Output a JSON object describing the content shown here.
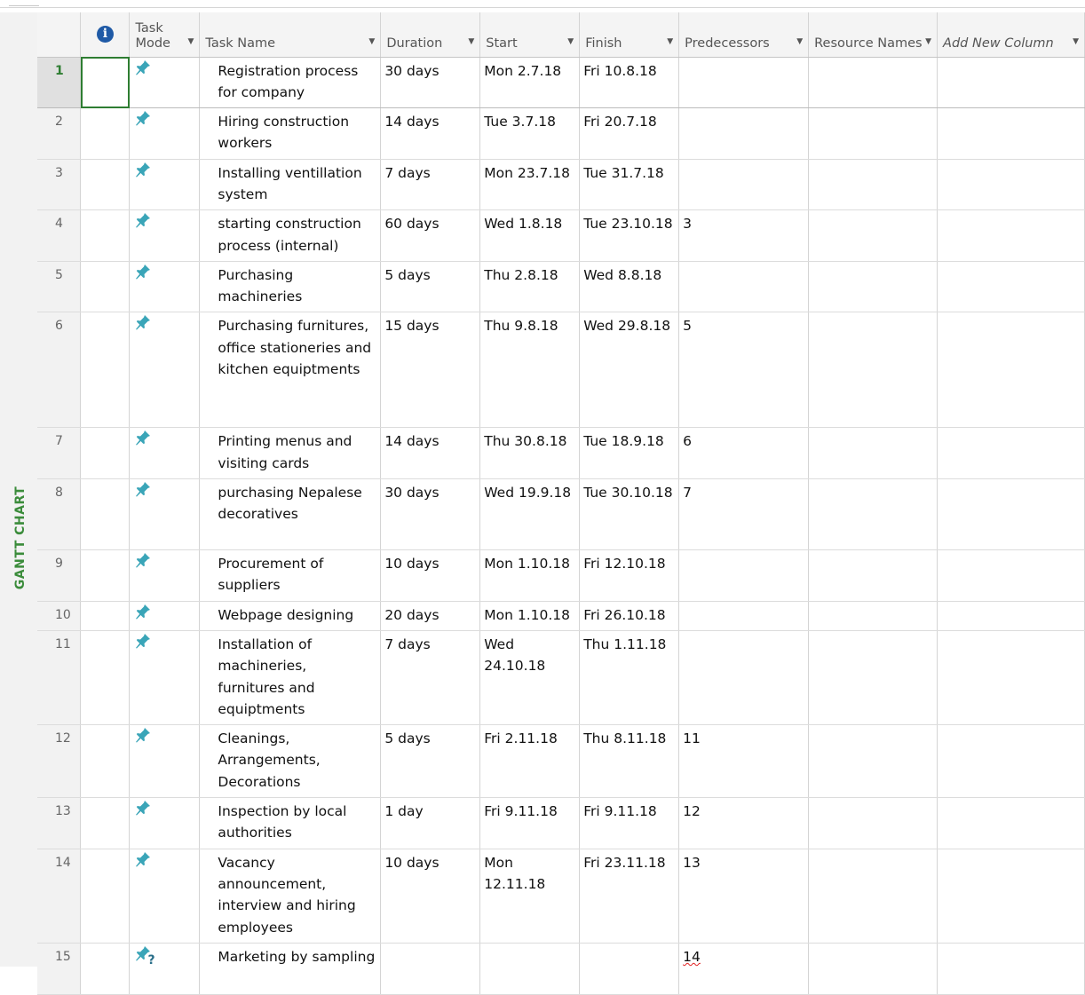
{
  "view": {
    "label": "GANTT CHART"
  },
  "columns": {
    "task_mode": "Task Mode",
    "task_name": "Task Name",
    "duration": "Duration",
    "start": "Start",
    "finish": "Finish",
    "predecessors": "Predecessors",
    "resource_names": "Resource Names",
    "add_new": "Add New Column"
  },
  "icons": {
    "info": "info-icon",
    "manual_pin": "pin-icon",
    "dropdown": "chevron-down-icon"
  },
  "colors": {
    "pin": "#3aa5b8",
    "selected_index": "#2e7d32",
    "view_label": "#3b8c3b",
    "info_icon": "#1f5aa6"
  },
  "tasks": [
    {
      "id": "1",
      "name": "Registration process for company",
      "duration": "30 days",
      "start": "Mon 2.7.18",
      "finish": "Fri 10.8.18",
      "predecessors": "",
      "resources": ""
    },
    {
      "id": "2",
      "name": "Hiring construction workers",
      "duration": "14 days",
      "start": "Tue 3.7.18",
      "finish": "Fri 20.7.18",
      "predecessors": "",
      "resources": ""
    },
    {
      "id": "3",
      "name": "Installing ventillation system",
      "duration": "7 days",
      "start": "Mon 23.7.18",
      "finish": "Tue 31.7.18",
      "predecessors": "",
      "resources": ""
    },
    {
      "id": "4",
      "name": "starting construction process (internal)",
      "duration": "60 days",
      "start": "Wed 1.8.18",
      "finish": "Tue 23.10.18",
      "predecessors": "3",
      "resources": ""
    },
    {
      "id": "5",
      "name": "Purchasing machineries",
      "duration": "5 days",
      "start": "Thu 2.8.18",
      "finish": "Wed 8.8.18",
      "predecessors": "",
      "resources": ""
    },
    {
      "id": "6",
      "name": "Purchasing furnitures, office stationeries and kitchen equiptments",
      "duration": "15 days",
      "start": "Thu 9.8.18",
      "finish": "Wed 29.8.18",
      "predecessors": "5",
      "resources": ""
    },
    {
      "id": "7",
      "name": "Printing menus and visiting cards",
      "duration": "14 days",
      "start": "Thu 30.8.18",
      "finish": "Tue 18.9.18",
      "predecessors": "6",
      "resources": ""
    },
    {
      "id": "8",
      "name": "purchasing Nepalese decoratives",
      "duration": "30 days",
      "start": "Wed 19.9.18",
      "finish": "Tue 30.10.18",
      "predecessors": "7",
      "resources": ""
    },
    {
      "id": "9",
      "name": "Procurement of suppliers",
      "duration": "10 days",
      "start": "Mon 1.10.18",
      "finish": "Fri 12.10.18",
      "predecessors": "",
      "resources": ""
    },
    {
      "id": "10",
      "name": "Webpage designing",
      "duration": "20 days",
      "start": "Mon 1.10.18",
      "finish": "Fri 26.10.18",
      "predecessors": "",
      "resources": ""
    },
    {
      "id": "11",
      "name": "Installation of machineries, furnitures and equiptments",
      "duration": "7 days",
      "start": "Wed 24.10.18",
      "finish": "Thu 1.11.18",
      "predecessors": "",
      "resources": ""
    },
    {
      "id": "12",
      "name": "Cleanings, Arrangements, Decorations",
      "duration": "5 days",
      "start": "Fri 2.11.18",
      "finish": "Thu 8.11.18",
      "predecessors": "11",
      "resources": ""
    },
    {
      "id": "13",
      "name": "Inspection by local authorities",
      "duration": "1 day",
      "start": "Fri 9.11.18",
      "finish": "Fri 9.11.18",
      "predecessors": "12",
      "resources": ""
    },
    {
      "id": "14",
      "name": "Vacancy announcement, interview and hiring employees",
      "duration": "10 days",
      "start": "Mon 12.11.18",
      "finish": "Fri 23.11.18",
      "predecessors": "13",
      "resources": ""
    },
    {
      "id": "15",
      "name": "Marketing by sampling",
      "duration": "",
      "start": "",
      "finish": "",
      "predecessors": "14",
      "resources": "",
      "manual_unscheduled": true
    }
  ]
}
